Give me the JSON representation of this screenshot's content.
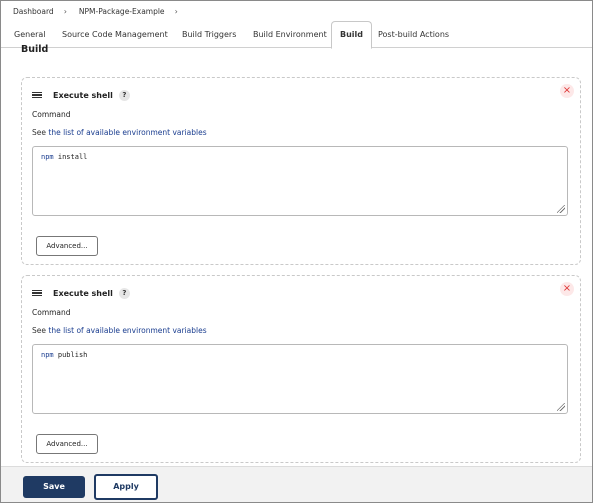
{
  "breadcrumb": {
    "items": [
      "Dashboard",
      "NPM-Package-Example"
    ],
    "separator": "›"
  },
  "tabs": [
    "General",
    "Source Code Management",
    "Build Triggers",
    "Build Environment",
    "Build",
    "Post-build Actions"
  ],
  "active_tab": "Build",
  "section": {
    "title": "Build"
  },
  "steps": [
    {
      "title": "Execute shell",
      "help": "?",
      "close": "×",
      "command_label": "Command",
      "see_prefix": "See ",
      "see_link": "the list of available environment variables",
      "command_keyword": "npm",
      "command_rest": " install",
      "advanced_label": "Advanced..."
    },
    {
      "title": "Execute shell",
      "help": "?",
      "close": "×",
      "command_label": "Command",
      "see_prefix": "See ",
      "see_link": "the list of available environment variables",
      "command_keyword": "npm",
      "command_rest": " publish",
      "advanced_label": "Advanced..."
    }
  ],
  "footer": {
    "save_label": "Save",
    "apply_label": "Apply"
  },
  "colors": {
    "primary": "#1f3a63",
    "link": "#1a3d8f",
    "close": "#dd3333"
  }
}
